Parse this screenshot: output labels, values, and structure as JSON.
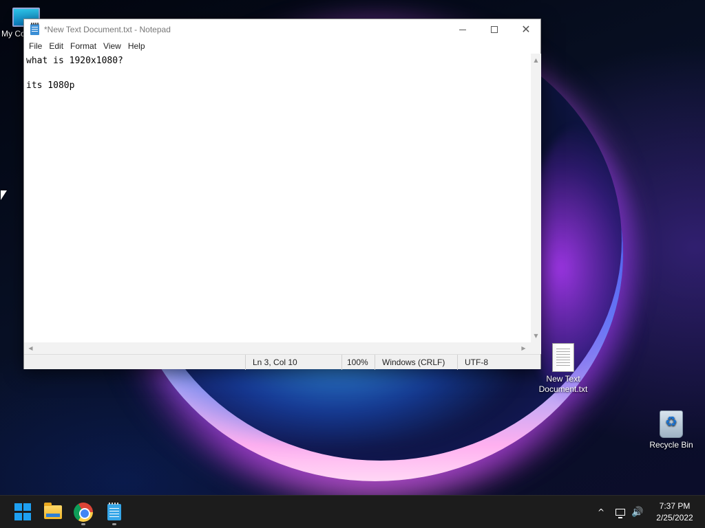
{
  "desktop": {
    "icons": [
      {
        "label": "My Computer",
        "icon": "monitor-icon"
      },
      {
        "label": "New Text Document.txt",
        "icon": "text-file-icon"
      },
      {
        "label": "Recycle Bin",
        "icon": "recycle-bin-icon"
      }
    ],
    "my_computer_label_visible": "My Co"
  },
  "window": {
    "title": "*New Text Document.txt - Notepad",
    "app_icon": "notepad-icon",
    "controls": {
      "minimize": "minimize-icon",
      "maximize": "maximize-icon",
      "close": "close-icon"
    }
  },
  "menu": {
    "items": [
      "File",
      "Edit",
      "Format",
      "View",
      "Help"
    ]
  },
  "editor": {
    "lines": [
      "what is 1920x1080?",
      "",
      "its 1080p"
    ]
  },
  "statusbar": {
    "position": "Ln 3, Col 10",
    "zoom": "100%",
    "line_endings": "Windows (CRLF)",
    "encoding": "UTF-8"
  },
  "taskbar": {
    "apps": [
      {
        "name": "Start",
        "icon": "windows-start-icon"
      },
      {
        "name": "File Explorer",
        "icon": "folder-icon"
      },
      {
        "name": "Google Chrome",
        "icon": "chrome-icon",
        "running": true
      },
      {
        "name": "Notepad",
        "icon": "notepad-icon",
        "running": true
      }
    ],
    "tray": {
      "chevron_glyph": "^",
      "volume_glyph": "🔊",
      "time": "7:37 PM",
      "date": "2/25/2022"
    }
  },
  "colors": {
    "accent": "#1ea0f2",
    "taskbar_bg": "#1c1c1c",
    "window_bg": "#ffffff",
    "statusbar_bg": "#f0f0f0"
  }
}
